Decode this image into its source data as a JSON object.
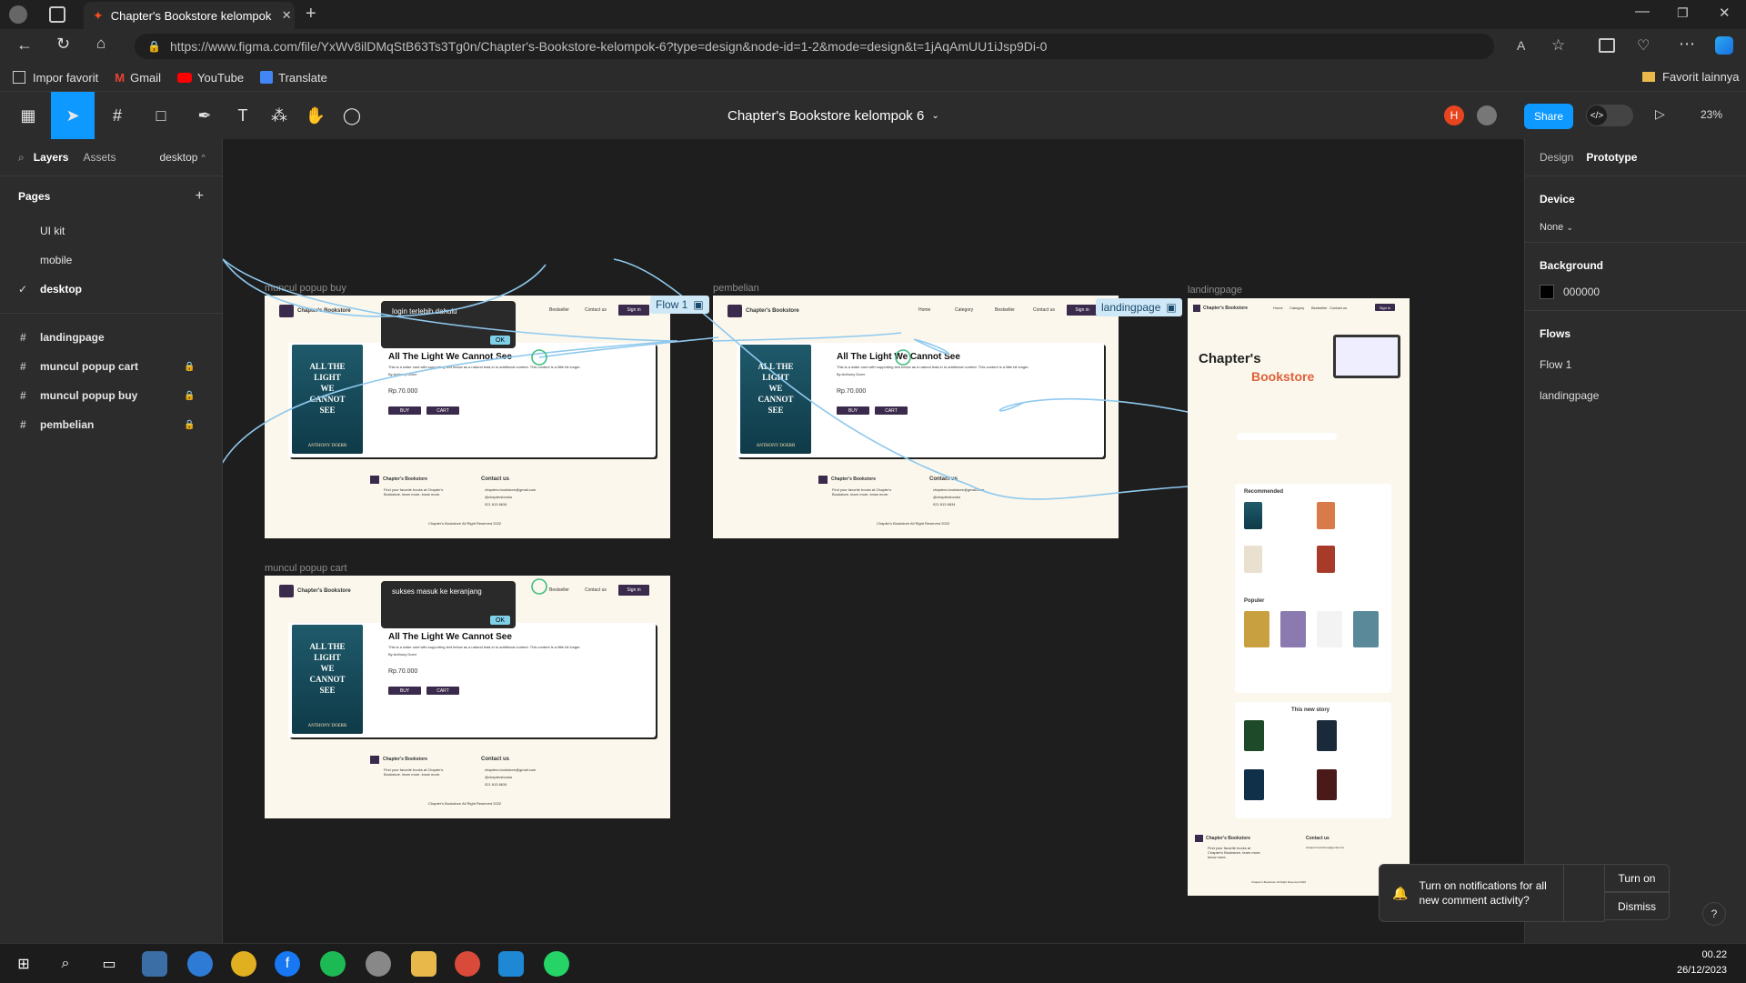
{
  "browser": {
    "tab_title": "Chapter's Bookstore kelompok 6",
    "url": "https://www.figma.com/file/YxWv8ilDMqStB63Ts3Tg0n/Chapter's-Bookstore-kelompok-6?type=design&node-id=1-2&mode=design&t=1jAqAmUU1iJsp9Di-0",
    "bookmarks": [
      "Impor favorit",
      "Gmail",
      "YouTube",
      "Translate"
    ],
    "favorites_label": "Favorit lainnya"
  },
  "toolbar": {
    "file_title": "Chapter's Bookstore kelompok 6",
    "avatar_letter": "H",
    "share_label": "Share",
    "zoom": "23%"
  },
  "left_panel": {
    "tabs": [
      "Layers",
      "Assets"
    ],
    "page_selector": "desktop",
    "pages_heading": "Pages",
    "pages": [
      "UI kit",
      "mobile",
      "desktop"
    ],
    "current_page": "desktop",
    "layers": [
      "landingpage",
      "muncul popup cart",
      "muncul popup buy",
      "pembelian"
    ]
  },
  "right_panel": {
    "tabs": [
      "Design",
      "Prototype"
    ],
    "device_heading": "Device",
    "device_value": "None",
    "background_heading": "Background",
    "background_value": "000000",
    "flows_heading": "Flows",
    "flows": [
      "Flow 1",
      "landingpage"
    ]
  },
  "canvas": {
    "frame_labels": [
      "muncul popup buy",
      "pembelian",
      "landingpage",
      "muncul popup cart"
    ],
    "flow_tags": [
      "Flow 1",
      "landingpage"
    ],
    "site_name": "Chapter's Bookstore",
    "book_title": "All The Light We Cannot See",
    "book_desc": "This is a wider card with supporting text below as a natural lead-in to additional content. This content is a little bit longer.",
    "book_author": "By Anthony Doerr",
    "book_cover": [
      "ALL THE",
      "LIGHT",
      "WE",
      "CANNOT",
      "SEE",
      "ANTHONY DOERR"
    ],
    "price": "Rp.70.000",
    "buy_label": "BUY",
    "cart_label": "CART",
    "popup_buy_text": "login terlebih dahulu",
    "popup_cart_text": "sukses masuk ke keranjang",
    "ok_label": "OK",
    "nav": [
      "Home",
      "Category",
      "Bestseller",
      "Contact us"
    ],
    "sign_in": "Sign in",
    "contact_heading": "Contact us",
    "footer_text": "Find your favorite books at Chapter's Bookstore, learn more, know more.",
    "contact_email": "chapters.bookstore@gmail.com",
    "contact_ig": "@chaptersbooks",
    "contact_phone": "021 813 6634",
    "copyright": "Chapter's Bookstore All Right Reserved 2022",
    "landing_title1": "Chapter's",
    "landing_title2": "Bookstore",
    "landing_sections": [
      "Recommended",
      "Populer",
      "This new story"
    ]
  },
  "notification": {
    "text": "Turn on notifications for all new comment activity?",
    "turn_on": "Turn on",
    "dismiss": "Dismiss"
  },
  "taskbar": {
    "time": "00.22",
    "date": "26/12/2023"
  },
  "colors": {
    "accent": "#0d99ff",
    "frame_bg": "#fbf7ec",
    "brand_purple": "#3a2a4c",
    "flow_blue": "#8fc9ee"
  }
}
